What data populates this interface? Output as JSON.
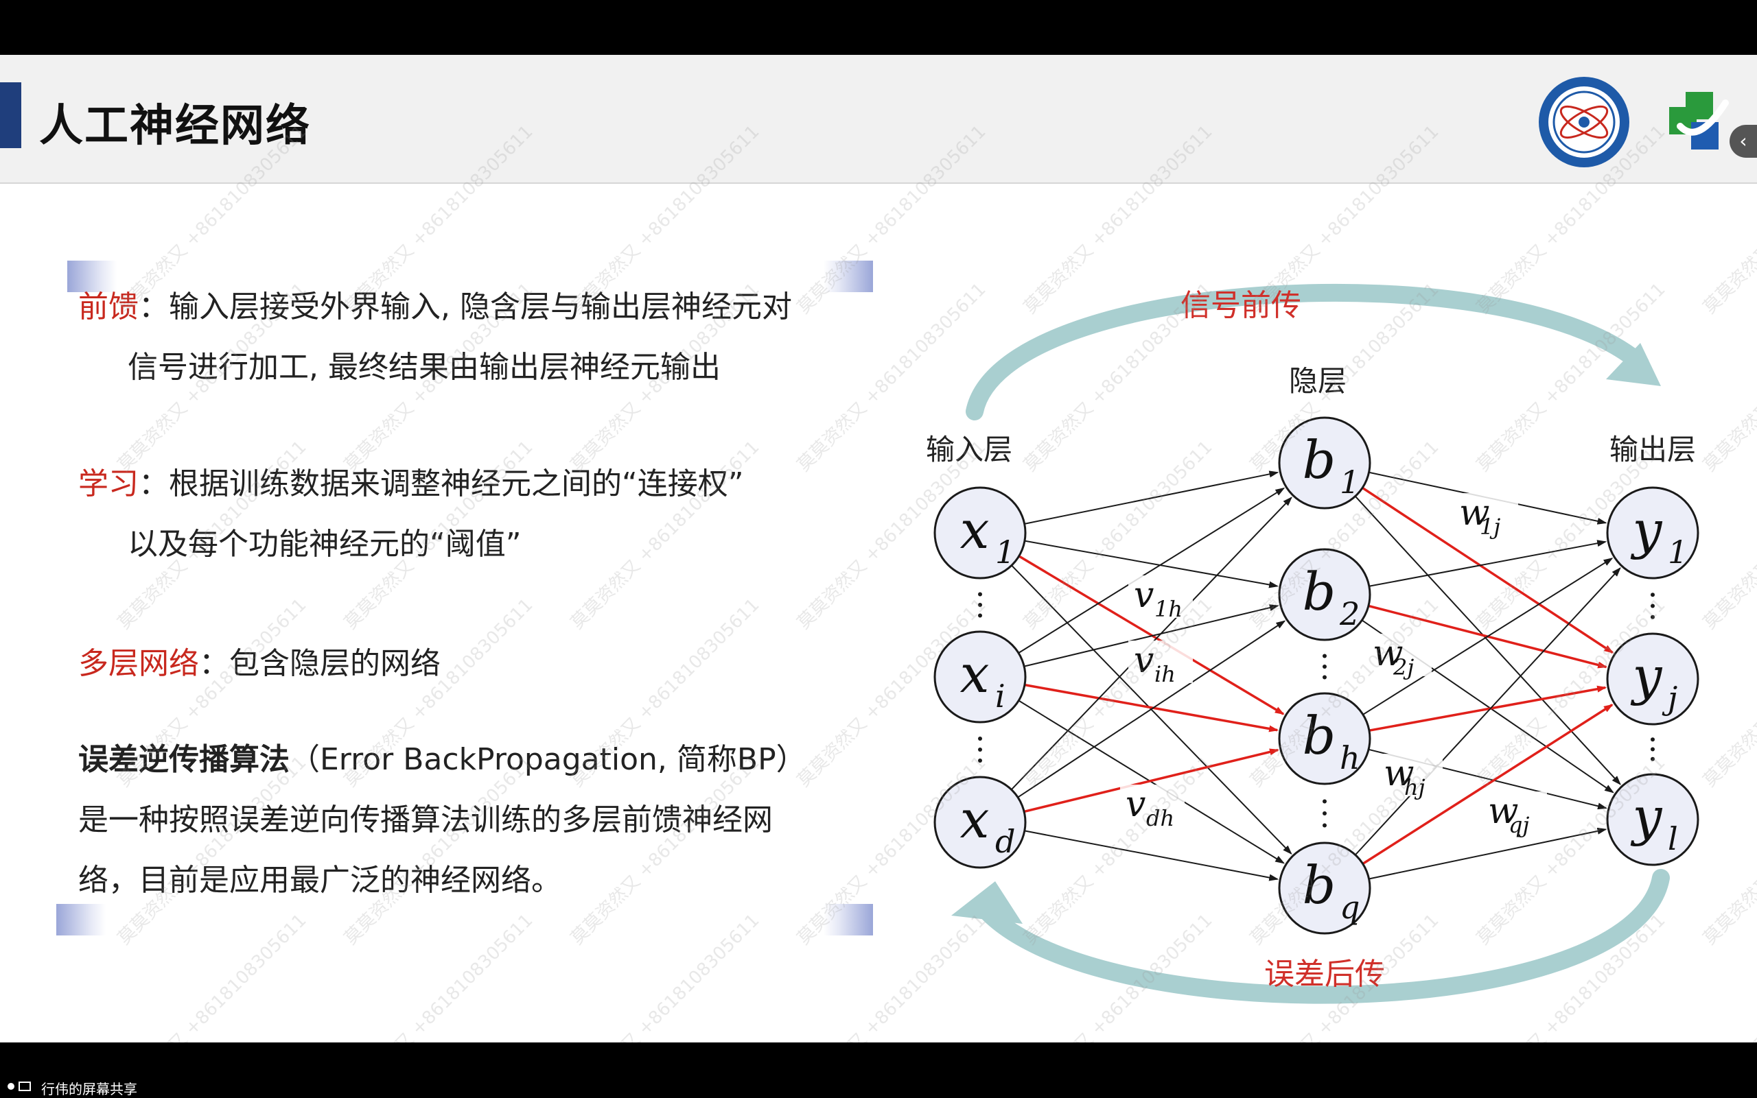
{
  "slide": {
    "title": "人工神经网络"
  },
  "sections": {
    "feedforward": {
      "term": "前馈",
      "line1": "：输入层接受外界输入, 隐含层与输出层神经元对",
      "line2": "信号进行加工, 最终结果由输出层神经元输出"
    },
    "learning": {
      "term": "学习",
      "line1": "：根据训练数据来调整神经元之间的“连接权”",
      "line2": "以及每个功能神经元的“阈值”"
    },
    "multilayer": {
      "term": "多层网络",
      "line1": "：包含隐层的网络"
    },
    "bp": {
      "term": "误差逆传播算法",
      "line1_rest": "（Error BackPropagation, 简称BP）",
      "line2": "是一种按照误差逆向传播算法训练的多层前馈神经网",
      "line3": "络，目前是应用最广泛的神经网络。"
    }
  },
  "diagram": {
    "top_arrow_label": "信号前传",
    "bottom_arrow_label": "误差后传",
    "input_layer_label": "输入层",
    "hidden_layer_label": "隐层",
    "output_layer_label": "输出层",
    "input_nodes": [
      {
        "base": "x",
        "sub": "1"
      },
      {
        "base": "x",
        "sub": "i"
      },
      {
        "base": "x",
        "sub": "d"
      }
    ],
    "hidden_nodes": [
      {
        "base": "b",
        "sub": "1"
      },
      {
        "base": "b",
        "sub": "2"
      },
      {
        "base": "b",
        "sub": "h"
      },
      {
        "base": "b",
        "sub": "q"
      }
    ],
    "output_nodes": [
      {
        "base": "y",
        "sub": "1"
      },
      {
        "base": "y",
        "sub": "j"
      },
      {
        "base": "y",
        "sub": "l"
      }
    ],
    "weights_v": [
      {
        "base": "v",
        "sub": "1h"
      },
      {
        "base": "v",
        "sub": "ih"
      },
      {
        "base": "v",
        "sub": "dh"
      }
    ],
    "weights_w": [
      {
        "base": "w",
        "sub": "1j"
      },
      {
        "base": "w",
        "sub": "2j"
      },
      {
        "base": "w",
        "sub": "hj"
      },
      {
        "base": "w",
        "sub": "qj"
      }
    ],
    "colors": {
      "node_fill": "#eceef8",
      "node_stroke": "#1a1a1a",
      "edge": "#1a1a1a",
      "highlight_edge": "#e0201a",
      "arrow": "#a9cfd0",
      "label_red": "#d0302a"
    }
  },
  "watermark": "莫莫资然又 +8618108305611",
  "taskbar": {
    "label": "行伟的屏幕共享"
  }
}
